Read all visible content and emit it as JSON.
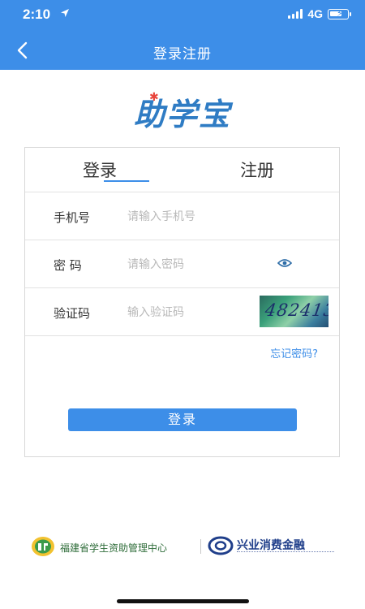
{
  "status_bar": {
    "time": "2:10",
    "network": "4G"
  },
  "nav": {
    "title": "登录注册",
    "back_icon": "chevron-left-icon"
  },
  "logo": {
    "text": "助学宝"
  },
  "tabs": [
    {
      "label": "登录",
      "active": true
    },
    {
      "label": "注册",
      "active": false
    }
  ],
  "form": {
    "phone": {
      "label": "手机号",
      "placeholder": "请输入手机号",
      "value": ""
    },
    "password": {
      "label": "密 码",
      "placeholder": "请输入密码",
      "value": "",
      "toggle_icon": "eye-icon"
    },
    "code": {
      "label": "验证码",
      "placeholder": "输入验证码",
      "value": "",
      "captcha": "482413"
    },
    "forgot_label": "忘记密码?",
    "submit_label": "登录"
  },
  "footer": {
    "left_org": "福建省学生资助管理中心",
    "right_org": "兴业消费金融"
  },
  "colors": {
    "primary": "#3d8ee8",
    "placeholder": "#b9b9b9",
    "border": "#d8d8d8"
  }
}
